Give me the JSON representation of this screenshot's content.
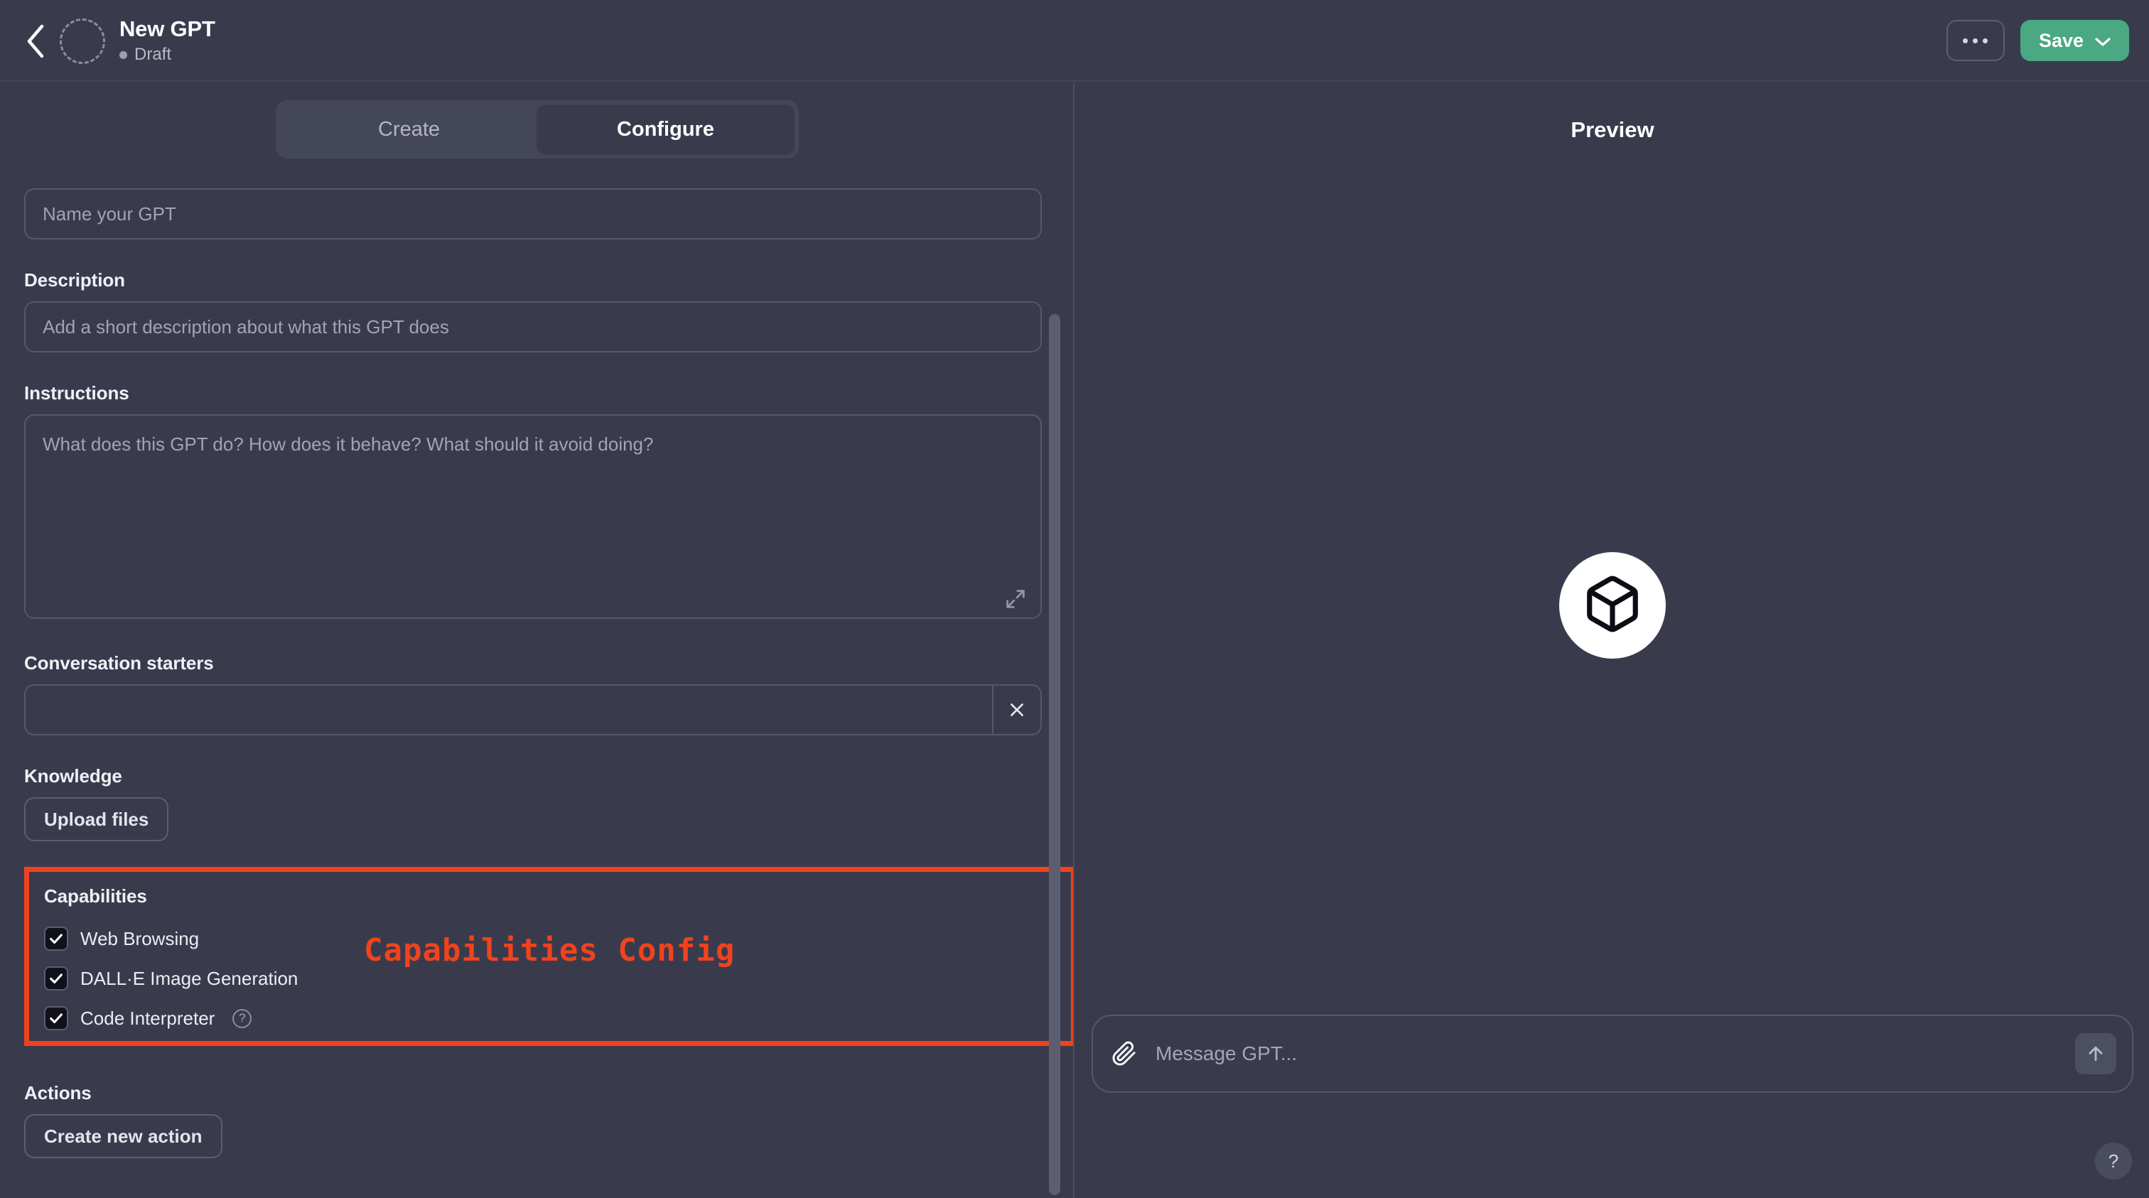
{
  "topbar": {
    "back_icon": "chevron-left-icon",
    "avatar_icon": "gpt-avatar-placeholder",
    "title": "New GPT",
    "status": "Draft",
    "more_label": "•••",
    "save_label": "Save",
    "save_caret_icon": "chevron-down-icon",
    "save_color": "#4aa882"
  },
  "tabs": [
    {
      "label": "Create",
      "active": false
    },
    {
      "label": "Configure",
      "active": true
    }
  ],
  "form": {
    "name": {
      "value": "",
      "placeholder": "Name your GPT"
    },
    "description": {
      "label": "Description",
      "value": "",
      "placeholder": "Add a short description about what this GPT does"
    },
    "instructions": {
      "label": "Instructions",
      "value": "",
      "placeholder": "What does this GPT do? How does it behave? What should it avoid doing?",
      "expand_icon": "expand-diagonal-icon"
    },
    "conversation_starters": {
      "label": "Conversation starters",
      "rows": [
        {
          "value": "",
          "placeholder": "",
          "remove_icon": "close-x-icon"
        }
      ]
    },
    "knowledge": {
      "label": "Knowledge",
      "upload_label": "Upload files"
    },
    "capabilities": {
      "label": "Capabilities",
      "items": [
        {
          "label": "Web Browsing",
          "checked": true,
          "has_help": false
        },
        {
          "label": "DALL·E Image Generation",
          "checked": true,
          "has_help": false
        },
        {
          "label": "Code Interpreter",
          "checked": true,
          "has_help": true,
          "help_label": "?"
        }
      ]
    },
    "actions": {
      "label": "Actions",
      "create_label": "Create new action"
    }
  },
  "annotation": {
    "text": "Capabilities Config",
    "color": "#f0431d"
  },
  "preview": {
    "title": "Preview",
    "logo_icon": "cube-icon",
    "composer": {
      "attach_icon": "paperclip-icon",
      "placeholder": "Message GPT...",
      "value": "",
      "send_icon": "arrow-up-icon"
    },
    "help_fab_label": "?"
  }
}
